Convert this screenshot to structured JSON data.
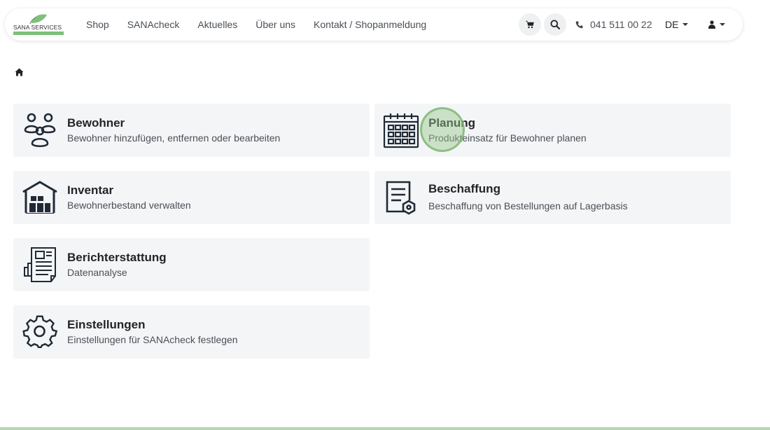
{
  "header": {
    "logo_text": "SANA SERVICES",
    "nav": [
      "Shop",
      "SANAcheck",
      "Aktuelles",
      "Über uns",
      "Kontakt / Shopanmeldung"
    ],
    "phone": "041 511 00 22",
    "language": "DE",
    "icons": {
      "cart": "cart-icon",
      "search": "search-icon",
      "phone": "phone-icon",
      "user": "user-icon"
    }
  },
  "breadcrumb": {
    "home_icon": "home-icon"
  },
  "cards": [
    {
      "title": "Bewohner",
      "description": "Bewohner hinzufügen, entfernen oder bearbeiten",
      "icon": "residents-icon"
    },
    {
      "title": "Planung",
      "description": "Produkteinsatz für Bewohner planen",
      "icon": "calendar-icon"
    },
    {
      "title": "Inventar",
      "description": "Bewohnerbestand verwalten",
      "icon": "warehouse-icon"
    },
    {
      "title": "Beschaffung",
      "description": "Beschaffung von Bestellungen auf Lagerbasis",
      "icon": "procurement-icon"
    },
    {
      "title": "Berichterstattung",
      "description": "Datenanalyse",
      "icon": "report-icon"
    },
    {
      "title": "Einstellungen",
      "description": "Einstellungen für SANAcheck festlegen",
      "icon": "gear-icon"
    }
  ],
  "colors": {
    "brand_green": "#7fbf7b",
    "card_bg": "#f4f5f7",
    "icon_dark": "#1f2a36"
  }
}
